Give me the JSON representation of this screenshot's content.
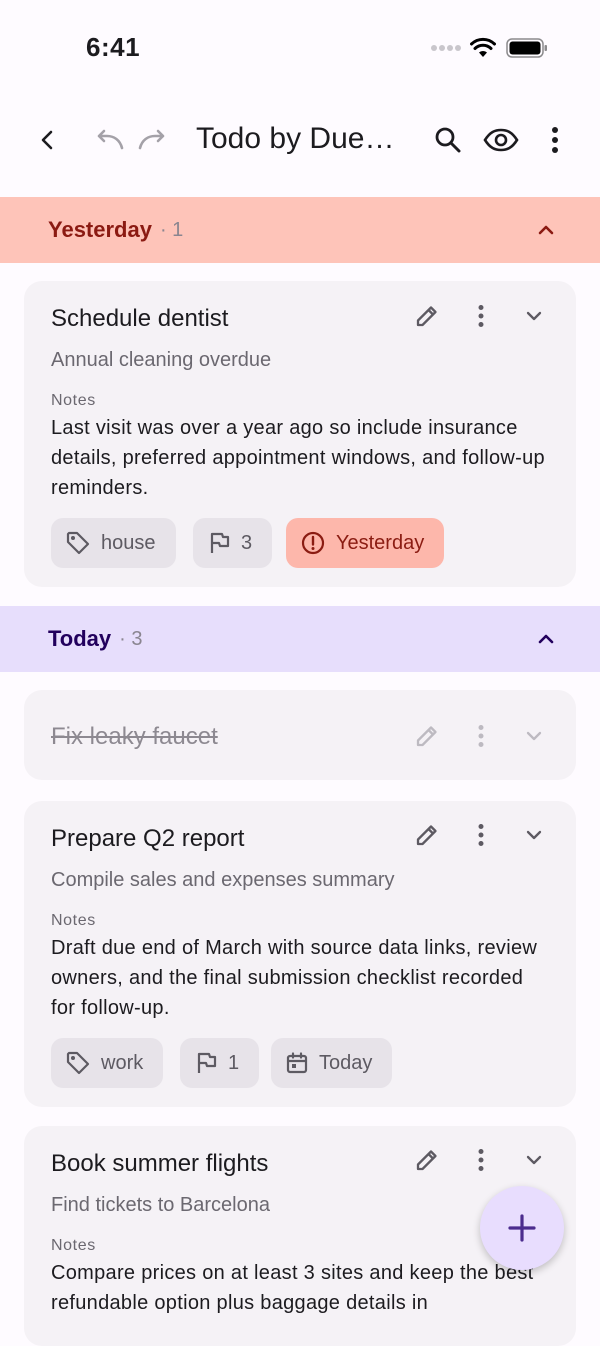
{
  "status_bar": {
    "time": "6:41"
  },
  "app_bar": {
    "title": "Todo by Due…"
  },
  "colors": {
    "yesterday_header_bg": "#fec4b9",
    "yesterday_header_text": "#8b1a12",
    "today_header_bg": "#e7defc",
    "today_header_text": "#22005d",
    "fab_bg": "#e8ddfe",
    "accent": "#4b2c8e"
  },
  "groups": [
    {
      "name": "Yesterday",
      "count": "· 1",
      "tasks": [
        {
          "title": "Schedule dentist",
          "subtitle": "Annual cleaning overdue",
          "notes_label": "Notes",
          "notes": "Last visit was over a year ago so include insurance details, preferred appointment windows, and follow-up reminders.",
          "chips": [
            {
              "icon": "tag-icon",
              "label": "house"
            },
            {
              "icon": "flag-icon",
              "label": "3"
            },
            {
              "icon": "alert-circle-icon",
              "label": "Yesterday"
            }
          ]
        }
      ]
    },
    {
      "name": "Today",
      "count": "· 3",
      "tasks": [
        {
          "title": "Fix leaky faucet",
          "completed": true
        },
        {
          "title": "Prepare Q2 report",
          "subtitle": "Compile sales and expenses summary",
          "notes_label": "Notes",
          "notes": "Draft due end of March with source data links, review owners, and the final submission checklist recorded for follow-up.",
          "chips": [
            {
              "icon": "tag-icon",
              "label": "work"
            },
            {
              "icon": "flag-icon",
              "label": "1"
            },
            {
              "icon": "calendar-icon",
              "label": "Today"
            }
          ]
        },
        {
          "title": "Book summer flights",
          "subtitle": "Find tickets to Barcelona",
          "notes_label": "Notes",
          "notes": "Compare prices on at least 3 sites and keep the best refundable option plus baggage details in"
        }
      ]
    }
  ]
}
